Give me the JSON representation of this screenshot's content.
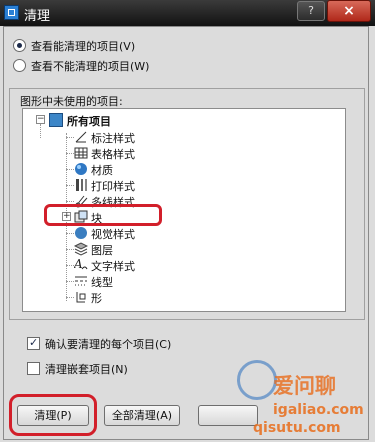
{
  "window": {
    "title": "清理",
    "help_label": "?",
    "close_label": "×"
  },
  "view_options": [
    {
      "label": "查看能清理的项目(V)",
      "checked": true
    },
    {
      "label": "查看不能清理的项目(W)",
      "checked": false
    }
  ],
  "tree": {
    "heading": "图形中未使用的项目:",
    "root": {
      "label": "所有项目",
      "expander": "−"
    },
    "items": [
      {
        "label": "标注样式",
        "icon": "dimension-style-icon"
      },
      {
        "label": "表格样式",
        "icon": "table-style-icon"
      },
      {
        "label": "材质",
        "icon": "material-icon"
      },
      {
        "label": "打印样式",
        "icon": "plot-style-icon"
      },
      {
        "label": "多线样式",
        "icon": "multiline-style-icon"
      },
      {
        "label": "块",
        "icon": "block-icon",
        "expander": "+",
        "highlighted": true
      },
      {
        "label": "视觉样式",
        "icon": "visual-style-icon"
      },
      {
        "label": "图层",
        "icon": "layer-icon"
      },
      {
        "label": "文字样式",
        "icon": "text-style-icon"
      },
      {
        "label": "线型",
        "icon": "linetype-icon"
      },
      {
        "label": "形",
        "icon": "shape-icon"
      }
    ]
  },
  "checkboxes": [
    {
      "label": "确认要清理的每个项目(C)",
      "checked": true
    },
    {
      "label": "清理嵌套项目(N)",
      "checked": false
    }
  ],
  "buttons": {
    "purge": "清理(P)",
    "purge_all": "全部清理(A)"
  },
  "watermark": {
    "line1": "爱问聊",
    "line2": "igaliao.com",
    "line3": "qisutu.com"
  },
  "colors": {
    "highlight": "#d21f2a",
    "selected": "#1c2a4a"
  }
}
